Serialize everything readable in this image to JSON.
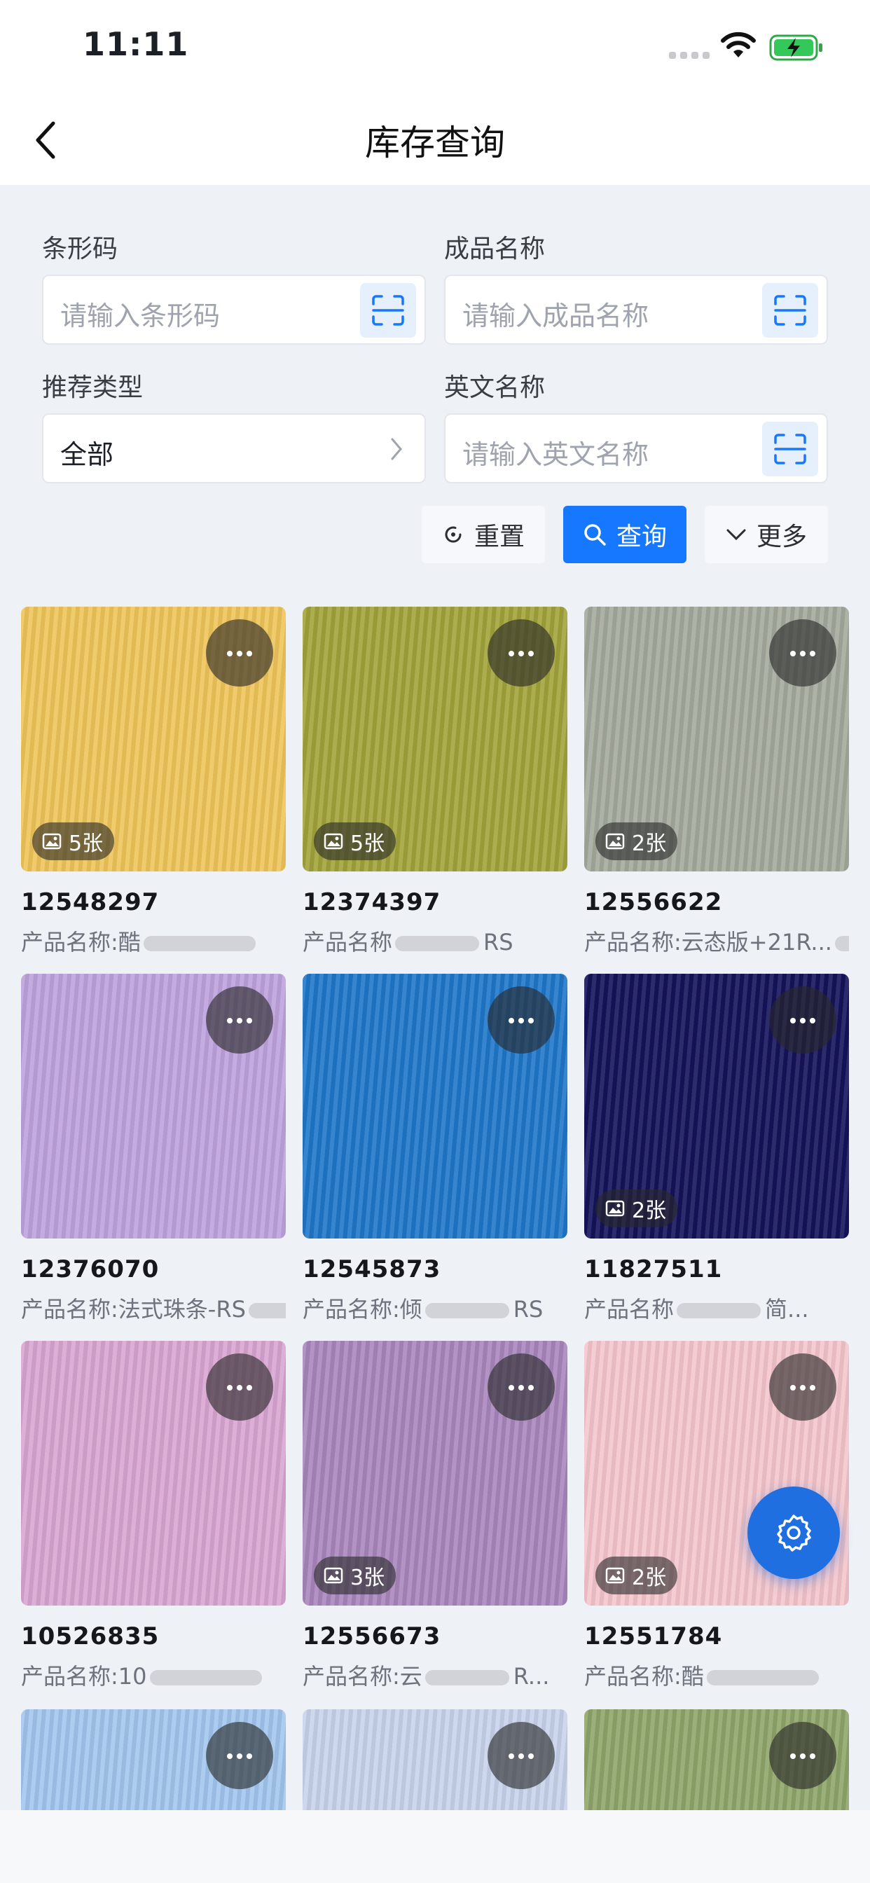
{
  "status": {
    "time": "11:11"
  },
  "nav": {
    "title": "库存查询"
  },
  "form": {
    "barcode": {
      "label": "条形码",
      "placeholder": "请输入条形码"
    },
    "product_name": {
      "label": "成品名称",
      "placeholder": "请输入成品名称"
    },
    "recommend_type": {
      "label": "推荐类型",
      "value": "全部"
    },
    "english_name": {
      "label": "英文名称",
      "placeholder": "请输入英文名称"
    }
  },
  "buttons": {
    "reset": "重置",
    "query": "查询",
    "more": "更多"
  },
  "products": [
    {
      "code": "12548297",
      "name_prefix": "产品名称:酷",
      "images": "5张",
      "color": "#efc55a"
    },
    {
      "code": "12374397",
      "name_prefix": "产品名称",
      "name_suffix": "RS",
      "images": "5张",
      "color": "#a2a43a"
    },
    {
      "code": "12556622",
      "name_prefix": "产品名称:云态版+21R...",
      "images": "2张",
      "color": "#a4aa9c"
    },
    {
      "code": "12376070",
      "name_prefix": "产品名称:法式珠条-RS",
      "images": "",
      "color": "#bea3dd"
    },
    {
      "code": "12545873",
      "name_prefix": "产品名称:倾",
      "name_suffix": "RS",
      "images": "",
      "color": "#1f77c9"
    },
    {
      "code": "11827511",
      "name_prefix": "产品名称",
      "name_suffix": "简...",
      "images": "2张",
      "color": "#14135a"
    },
    {
      "code": "10526835",
      "name_prefix": "产品名称:10",
      "images": "",
      "color": "#d9a6d2"
    },
    {
      "code": "12556673",
      "name_prefix": "产品名称:云",
      "name_suffix": "R...",
      "images": "3张",
      "color": "#a987bd"
    },
    {
      "code": "12551784",
      "name_prefix": "产品名称:酷",
      "images": "2张",
      "color": "#f4c6cc"
    },
    {
      "code": "",
      "name_prefix": "",
      "images": "",
      "color": "#a3c6ee"
    },
    {
      "code": "",
      "name_prefix": "",
      "images": "",
      "color": "#c8d3ec"
    },
    {
      "code": "",
      "name_prefix": "",
      "images": "",
      "color": "#8ea66a"
    }
  ]
}
